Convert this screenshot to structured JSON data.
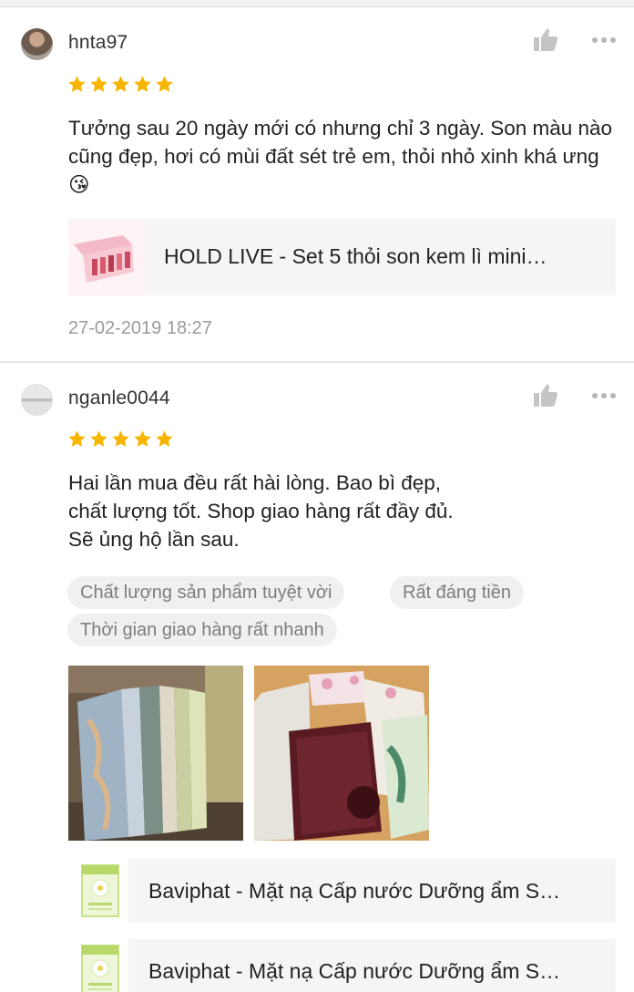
{
  "reviews": [
    {
      "username": "hnta97",
      "rating": 5,
      "text": "Tưởng sau 20 ngày mới có nhưng chỉ 3 ngày. Son màu nào cũng đẹp, hơi có mùi đất sét trẻ em, thỏi nhỏ xinh khá ưng 😘",
      "product": "HOLD LIVE - Set 5 thỏi son kem lì mini…",
      "date": "27-02-2019 18:27"
    },
    {
      "username": "nganle0044",
      "rating": 5,
      "text_lines": [
        "Hai lần mua đều rất hài lòng. Bao bì đẹp,",
        "chất lượng tốt. Shop giao hàng rất đầy đủ.",
        "Sẽ ủng hộ lần sau."
      ],
      "tags": [
        "Chất lượng sản phẩm tuyệt vời",
        "Rất đáng tiền",
        "Thời gian giao hàng rất nhanh"
      ],
      "products": [
        "Baviphat - Mặt nạ Cấp nước Dưỡng ẩm S…",
        "Baviphat - Mặt nạ Cấp nước Dưỡng ẩm S…"
      ]
    }
  ],
  "colors": {
    "star": "#f7b500",
    "muted": "#9a9a9a",
    "panel": "#f5f5f5",
    "icon": "#c4c4c4"
  },
  "icons": [
    "thumbs-up-icon",
    "more-dots-icon",
    "star-icon"
  ]
}
